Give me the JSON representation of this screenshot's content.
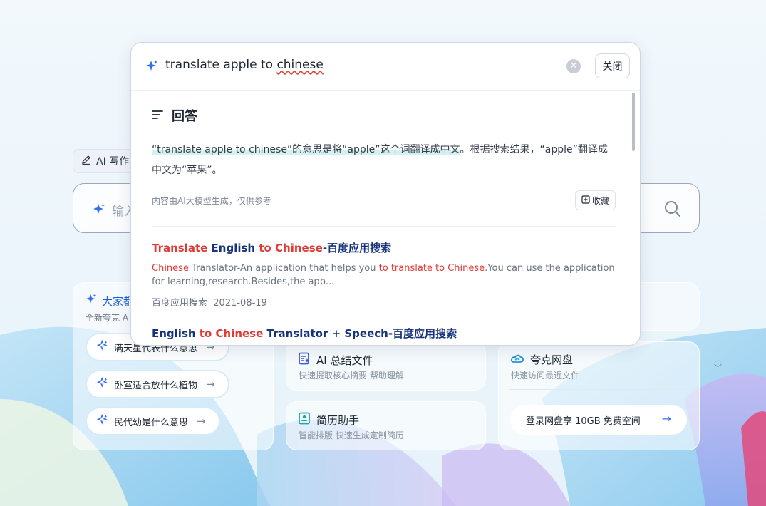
{
  "background": {
    "ai_write_tab": "AI 写作",
    "search_placeholder": "输入",
    "left_card": {
      "heading": "大家都",
      "sub": "全新夸克 A",
      "pills": [
        "满天星代表什么意思",
        "卧室适合放什么植物",
        "民代幼是什么意思"
      ]
    },
    "ai_summary": {
      "title": "AI 总结文件",
      "sub": "快速提取核心摘要 帮助理解"
    },
    "resume": {
      "title": "简历助手",
      "sub": "智能排版 快速生成定制简历"
    },
    "cloud": {
      "title": "夸克网盘",
      "sub": "快速访问最近文件",
      "button": "登录网盘享 10GB 免费空间"
    },
    "scroll_up": "︿",
    "scroll_down": "﹀"
  },
  "popup": {
    "query_part1": "translate apple to ",
    "query_part2": "chinese",
    "clear_symbol": "✕",
    "close_label": "关闭",
    "answer": {
      "heading": "回答",
      "body_highlight": "“translate apple to chinese”的意思是将“apple”这个词翻译成中文",
      "body_rest": "。根据搜索结果，“apple”翻译成中文为“苹果”。",
      "note": "内容由AI大模型生成，仅供参考",
      "collect": "收藏"
    },
    "results": [
      {
        "title_parts": [
          {
            "text": "Translate",
            "red": true
          },
          {
            "text": " English ",
            "red": false
          },
          {
            "text": "to",
            "red": true
          },
          {
            "text": " ",
            "red": false
          },
          {
            "text": "Chinese",
            "red": true
          },
          {
            "text": "-百度应用搜索",
            "red": false
          }
        ],
        "snippet_parts": [
          {
            "text": "Chinese",
            "red": true
          },
          {
            "text": " Translator-An application that helps you ",
            "red": false
          },
          {
            "text": "to translate to Chinese",
            "red": true
          },
          {
            "text": ".You can use the application for learning,research.Besides,the app...",
            "red": false
          }
        ],
        "source": "百度应用搜索",
        "date": "2021-08-19"
      },
      {
        "title_parts": [
          {
            "text": "English ",
            "red": false
          },
          {
            "text": "to",
            "red": true
          },
          {
            "text": " ",
            "red": false
          },
          {
            "text": "Chinese",
            "red": true
          },
          {
            "text": " Translator + Speech-百度应用搜索",
            "red": false
          }
        ]
      }
    ]
  },
  "colors": {
    "accent_blue": "#1f5fd6",
    "result_title": "#17337c",
    "highlight_red": "#e03b36",
    "answer_highlight": "#d4f1f1"
  }
}
